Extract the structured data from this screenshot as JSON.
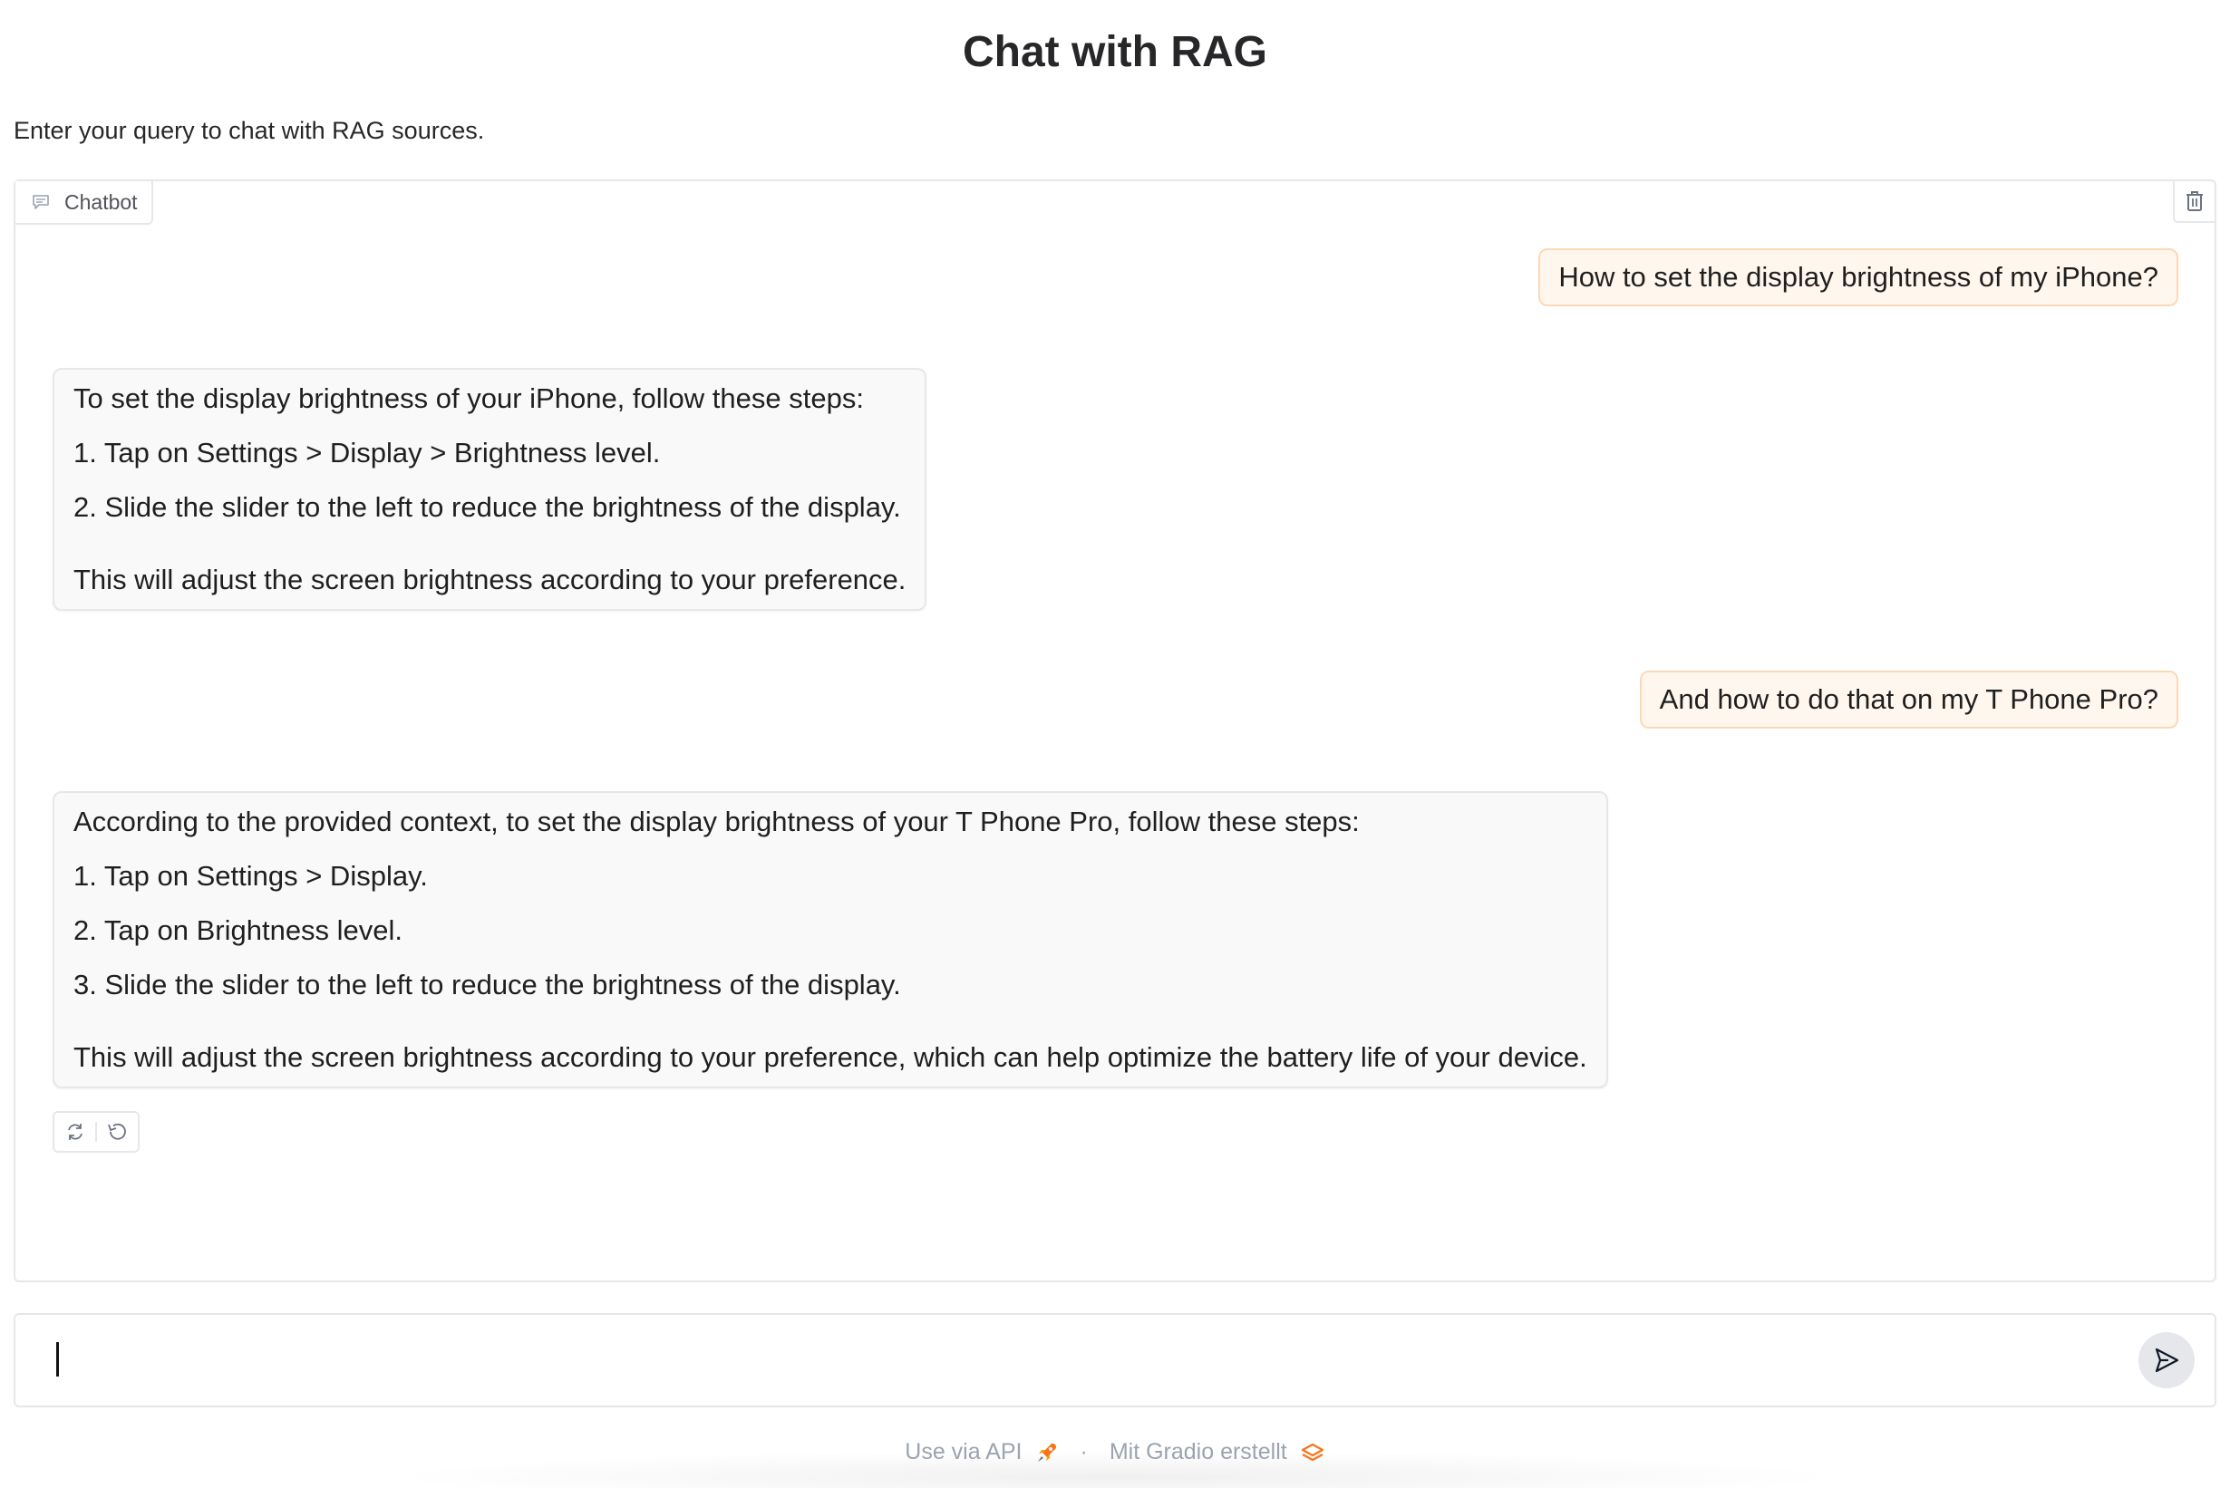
{
  "header": {
    "title": "Chat with RAG",
    "subtitle": "Enter your query to chat with RAG sources."
  },
  "chatbot": {
    "label": "Chatbot",
    "label_icon": "chat-bubble-icon",
    "clear_icon": "trash-icon",
    "messages": [
      {
        "role": "user",
        "text": "How to set the display brightness of my iPhone?"
      },
      {
        "role": "bot",
        "lines": [
          "To set the display brightness of your iPhone, follow these steps:",
          "1. Tap on Settings > Display > Brightness level.",
          "2. Slide the slider to the left to reduce the brightness of the display.",
          "This will adjust the screen brightness according to your preference."
        ]
      },
      {
        "role": "user",
        "text": "And how to do that on my T Phone Pro?"
      },
      {
        "role": "bot",
        "lines": [
          "According to the provided context, to set the display brightness of your T Phone Pro, follow these steps:",
          "1. Tap on Settings > Display.",
          "2. Tap on Brightness level.",
          "3. Slide the slider to the left to reduce the brightness of the display.",
          "This will adjust the screen brightness according to your preference, which can help optimize the battery life of your device."
        ]
      }
    ],
    "actions": {
      "retry_icon": "retry-icon",
      "undo_icon": "undo-icon"
    }
  },
  "input": {
    "value": "",
    "placeholder": "",
    "send_icon": "send-icon"
  },
  "footer": {
    "api_label": "Use via API",
    "api_icon": "rocket-icon",
    "separator": "·",
    "built_label": "Mit Gradio erstellt",
    "gradio_icon": "gradio-logo-icon"
  },
  "colors": {
    "user_bubble_bg": "#fff7ed",
    "user_bubble_border": "#fcd9b6",
    "bot_bubble_bg": "#f9f9f9",
    "accent": "#f97316"
  }
}
